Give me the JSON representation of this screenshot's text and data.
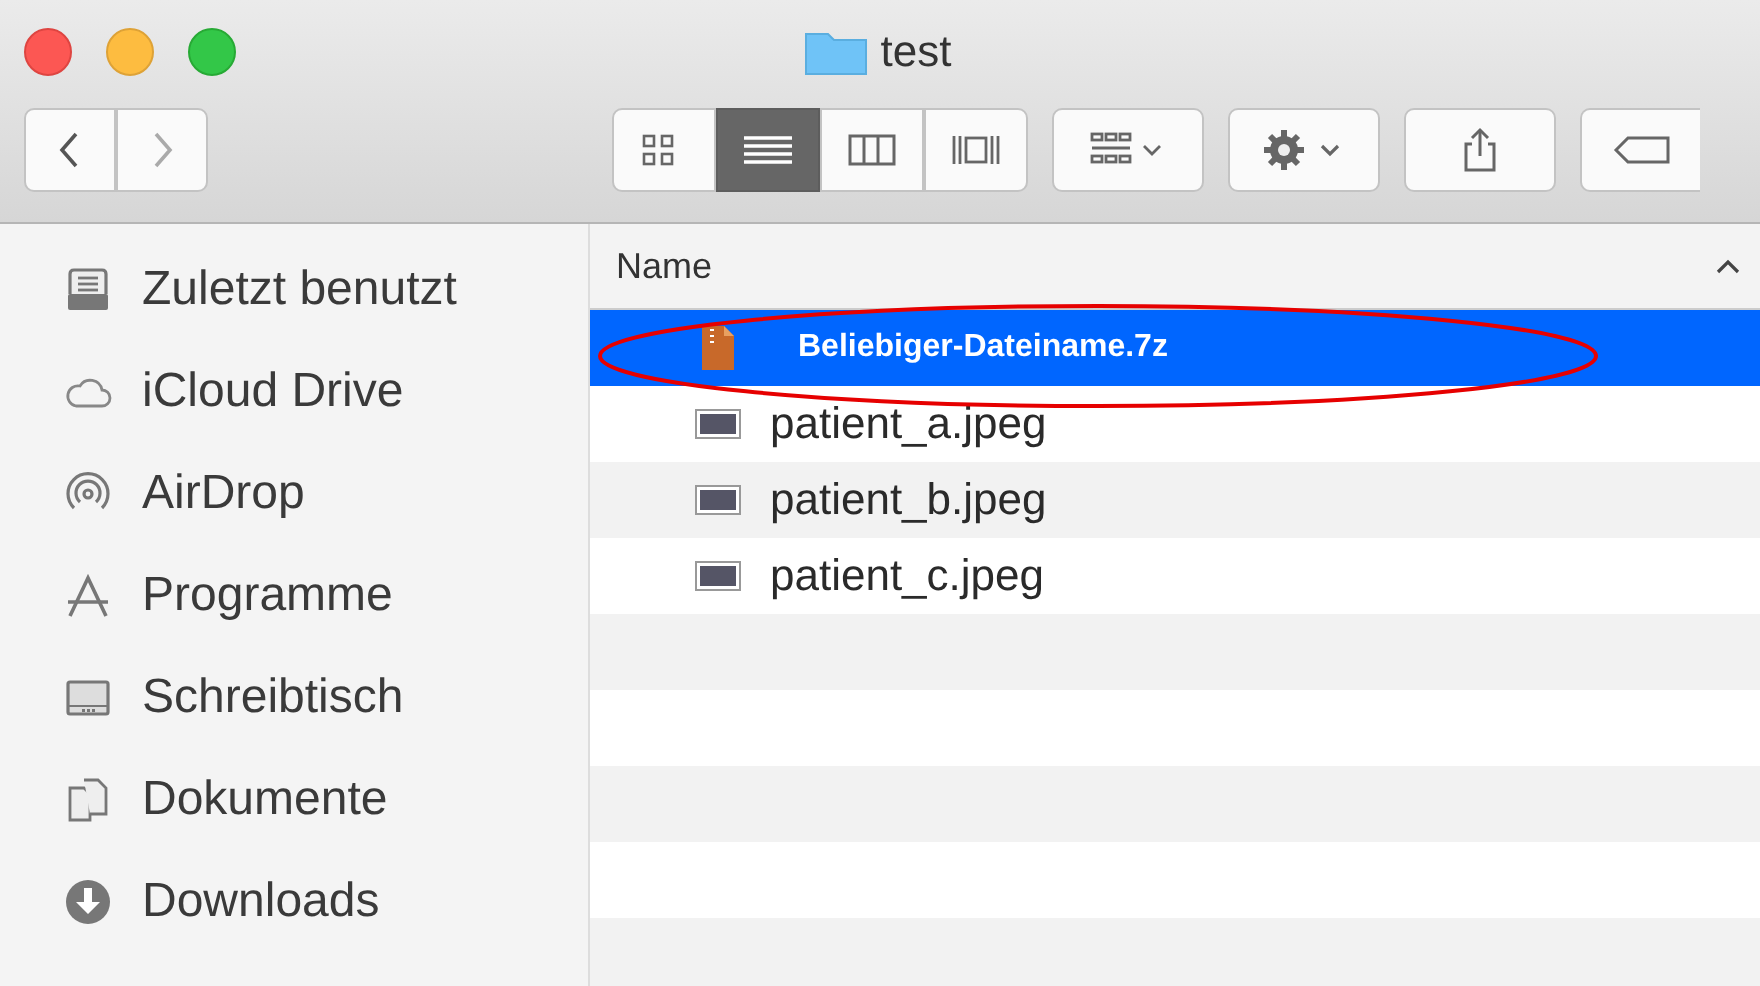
{
  "window": {
    "title": "test"
  },
  "navigation": [
    {
      "disabled": false
    },
    {
      "disabled": true
    }
  ],
  "view_modes": [
    {
      "selected": false
    },
    {
      "selected": true
    },
    {
      "selected": false
    },
    {
      "selected": false
    }
  ],
  "sidebar": {
    "items": [
      {
        "label": "Zuletzt benutzt"
      },
      {
        "label": "iCloud Drive"
      },
      {
        "label": "AirDrop"
      },
      {
        "label": "Programme"
      },
      {
        "label": "Schreibtisch"
      },
      {
        "label": "Dokumente"
      },
      {
        "label": "Downloads"
      }
    ]
  },
  "table": {
    "columns": [
      {
        "label": "Name"
      }
    ],
    "rows": [
      {
        "name": "Beliebiger-Dateiname.7z",
        "kind": "archive",
        "selected": true
      },
      {
        "name": "patient_a.jpeg",
        "kind": "image",
        "selected": false
      },
      {
        "name": "patient_b.jpeg",
        "kind": "image",
        "selected": false
      },
      {
        "name": "patient_c.jpeg",
        "kind": "image",
        "selected": false
      }
    ]
  },
  "annotations": [
    {
      "kind": "ellipse",
      "color": "#e60000"
    }
  ]
}
